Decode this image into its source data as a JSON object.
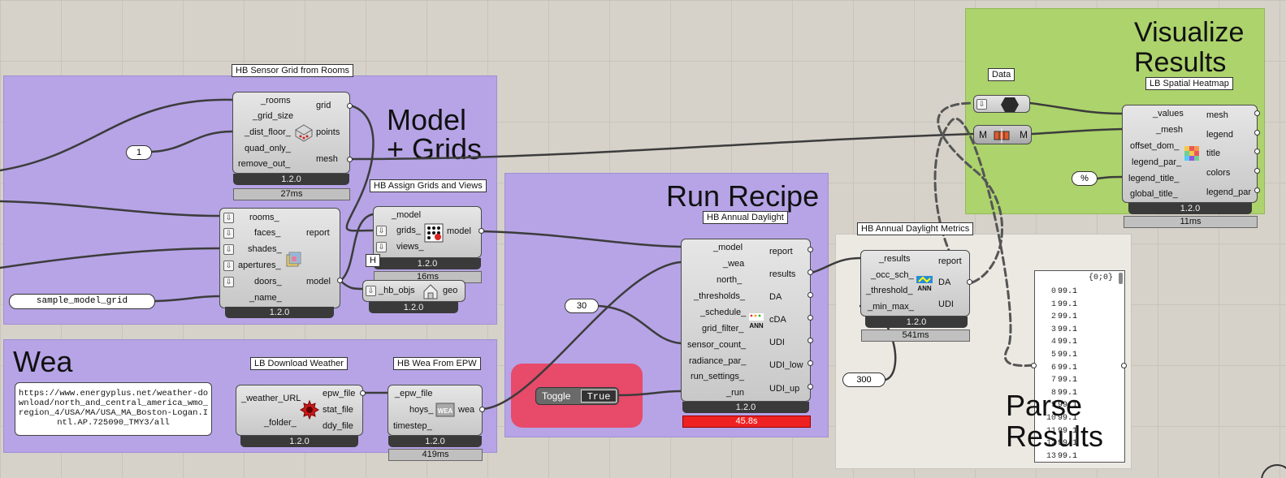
{
  "groups": {
    "model_grids": "Model\n+ Grids",
    "run_recipe": "Run Recipe",
    "wea": "Wea",
    "visualize": "Visualize\nResults",
    "parse": "Parse\nResults"
  },
  "components": {
    "sensor_grid": {
      "caption": "HB Sensor Grid from Rooms",
      "inputs": [
        "_rooms",
        "_grid_size",
        "_dist_floor_",
        "quad_only_",
        "remove_out_"
      ],
      "outputs": [
        "grid",
        "points",
        "mesh"
      ],
      "version": "1.2.0",
      "time": "27ms"
    },
    "model": {
      "inputs": [
        "rooms_",
        "faces_",
        "shades_",
        "apertures_",
        "doors_",
        "_name_"
      ],
      "outputs": [
        "report",
        "model"
      ],
      "version": "1.2.0"
    },
    "assign": {
      "caption": "HB Assign Grids and Views",
      "inputs": [
        "_model",
        "grids_",
        "views_"
      ],
      "outputs": [
        "model"
      ],
      "version": "1.2.0",
      "time": "16ms"
    },
    "hb_mini": {
      "caption": "H",
      "inputs": [
        "_hb_objs"
      ],
      "outputs": [
        "geo"
      ],
      "version": "1.2.0"
    },
    "download": {
      "caption": "LB Download Weather",
      "inputs": [
        "_weather_URL",
        "_folder_"
      ],
      "outputs": [
        "epw_file",
        "stat_file",
        "ddy_file"
      ],
      "version": "1.2.0"
    },
    "wea_from_epw": {
      "caption": "HB Wea From EPW",
      "inputs": [
        "_epw_file",
        "hoys_",
        "timestep_"
      ],
      "outputs": [
        "wea"
      ],
      "version": "1.2.0",
      "time": "419ms"
    },
    "annual": {
      "caption": "HB Annual Daylight",
      "inputs": [
        "_model",
        "_wea",
        "north_",
        "_thresholds_",
        "_schedule_",
        "grid_filter_",
        "sensor_count_",
        "radiance_par_",
        "run_settings_",
        "_run"
      ],
      "outputs": [
        "report",
        "results",
        "DA",
        "cDA",
        "UDI",
        "UDI_low",
        "UDI_up"
      ],
      "version": "1.2.0",
      "time": "45.8s"
    },
    "metrics": {
      "caption": "HB Annual Daylight Metrics",
      "inputs": [
        "_results",
        "_occ_sch_",
        "_threshold_",
        "_min_max_"
      ],
      "outputs": [
        "report",
        "DA",
        "UDI"
      ],
      "version": "1.2.0",
      "time": "541ms"
    },
    "heatmap": {
      "caption": "LB Spatial Heatmap",
      "inputs": [
        "_values",
        "_mesh",
        "offset_dom_",
        "legend_par_",
        "legend_title_",
        "global_title_"
      ],
      "outputs": [
        "mesh",
        "legend",
        "title",
        "colors",
        "legend_par"
      ],
      "version": "1.2.0",
      "time": "11ms"
    },
    "data": {
      "caption": "Data"
    },
    "mesh_param": {
      "left": "M",
      "right": "M"
    }
  },
  "params": {
    "one": "1",
    "model_name": "sample_model_grid",
    "thirty": "30",
    "three_hundred": "300",
    "percent": "%",
    "url": "https://www.energyplus.net/weather-download/north_and_central_america_wmo_region_4/USA/MA/USA_MA_Boston-Logan.Intl.AP.725090_TMY3/all"
  },
  "toggle": {
    "label": "Toggle",
    "value": "True"
  },
  "panel_list": {
    "path": "{0;0}",
    "rows": [
      {
        "i": "0",
        "v": "99.1"
      },
      {
        "i": "1",
        "v": "99.1"
      },
      {
        "i": "2",
        "v": "99.1"
      },
      {
        "i": "3",
        "v": "99.1"
      },
      {
        "i": "4",
        "v": "99.1"
      },
      {
        "i": "5",
        "v": "99.1"
      },
      {
        "i": "6",
        "v": "99.1"
      },
      {
        "i": "7",
        "v": "99.1"
      },
      {
        "i": "8",
        "v": "99.1"
      },
      {
        "i": "9",
        "v": "99.1"
      },
      {
        "i": "10",
        "v": "99.1"
      },
      {
        "i": "11",
        "v": "99.1"
      },
      {
        "i": "12",
        "v": "99.1"
      },
      {
        "i": "13",
        "v": "99.1"
      }
    ]
  },
  "colors": {
    "purple_group": "#b6a4e6",
    "green_group": "#acd36c",
    "red_group": "#e84a6a",
    "error_time": "#e22222"
  }
}
